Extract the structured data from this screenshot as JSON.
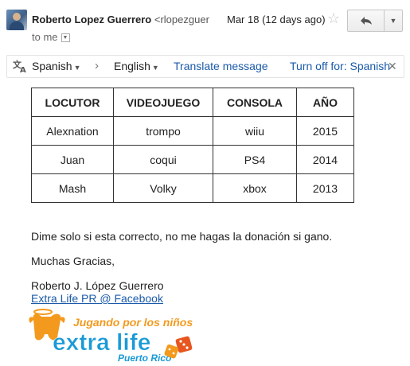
{
  "header": {
    "sender_name": "Roberto Lopez Guerrero",
    "sender_email": "<rlopezguer",
    "date": "Mar 18 (12 days ago)",
    "to": "to me",
    "icons": {
      "avatar": "avatar",
      "star": "star-icon",
      "reply": "reply-icon",
      "more": "chevron-down-icon"
    }
  },
  "translate": {
    "source_lang": "Spanish",
    "target_lang": "English",
    "translate_label": "Translate message",
    "turn_off_label": "Turn off for: Spanish",
    "icons": {
      "translate": "translate-icon",
      "arrow": "chevron-right-icon",
      "close": "close-icon"
    }
  },
  "table": {
    "headers": [
      "LOCUTOR",
      "VIDEOJUEGO",
      "CONSOLA",
      "AÑO"
    ],
    "rows": [
      [
        "Alexnation",
        "trompo",
        "wiiu",
        "2015"
      ],
      [
        "Juan",
        "coqui",
        "PS4",
        "2014"
      ],
      [
        "Mash",
        "Volky",
        "xbox",
        "2013"
      ]
    ]
  },
  "body": {
    "line1": "Dime solo si esta correcto, no me hagas la donación si gano.",
    "line2": "Muchas Gracias,"
  },
  "signature": {
    "name": "Roberto J. López Guerrero",
    "link": "Extra Life PR @ Facebook"
  },
  "logo": {
    "tagline": "Jugando por los niños",
    "brand": "extra life",
    "region": "Puerto Rico",
    "colors": {
      "orange": "#f39a1e",
      "blue": "#1a9ad6",
      "dice": "#e8561f"
    }
  }
}
